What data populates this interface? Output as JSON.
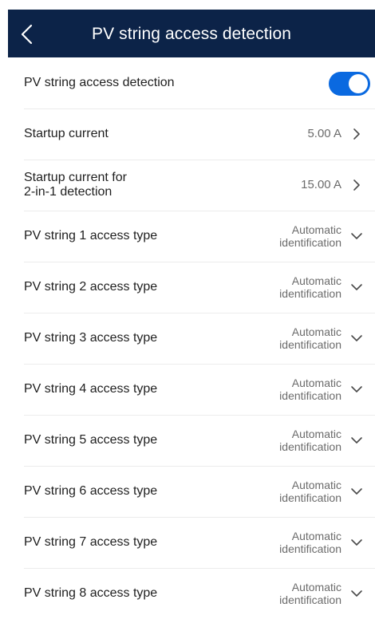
{
  "header": {
    "title": "PV string access detection"
  },
  "settings": {
    "detection": {
      "label": "PV string access detection",
      "enabled": true,
      "accent_color": "#0a69e0"
    },
    "startup_current": {
      "label": "Startup current",
      "value": "5.00 A"
    },
    "startup_current_2in1": {
      "label": "Startup current for\n2-in-1 detection",
      "value": "15.00 A"
    },
    "strings": [
      {
        "label": "PV string 1 access type",
        "value_line1": "Automatic",
        "value_line2": "identification"
      },
      {
        "label": "PV string 2 access type",
        "value_line1": "Automatic",
        "value_line2": "identification"
      },
      {
        "label": "PV string 3 access type",
        "value_line1": "Automatic",
        "value_line2": "identification"
      },
      {
        "label": "PV string 4 access type",
        "value_line1": "Automatic",
        "value_line2": "identification"
      },
      {
        "label": "PV string 5 access type",
        "value_line1": "Automatic",
        "value_line2": "identification"
      },
      {
        "label": "PV string 6 access type",
        "value_line1": "Automatic",
        "value_line2": "identification"
      },
      {
        "label": "PV string 7 access type",
        "value_line1": "Automatic",
        "value_line2": "identification"
      },
      {
        "label": "PV string 8 access type",
        "value_line1": "Automatic",
        "value_line2": "identification"
      }
    ]
  },
  "colors": {
    "header_background": "#0c2348",
    "header_text": "#ffffff",
    "label_text": "#1f1f1f",
    "value_text": "#6b6b6b"
  }
}
